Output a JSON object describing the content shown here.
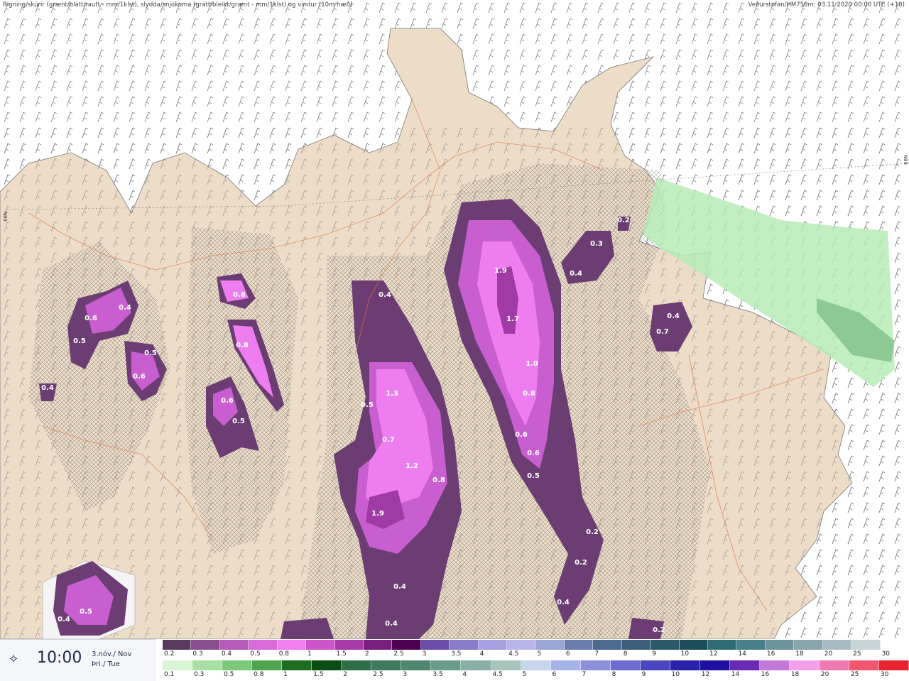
{
  "header": {
    "left_title": "Rigning/skúrir (grænt/blátt/rautt - mm/1klst), slydda/snjókoma (grátt/bleikt/grænt - mm/1klst) og vindur (10m hæð)",
    "right_title": "Veðurstofan/HM750m: 03.11.2020 00:00 UTC (+10)"
  },
  "grid_labels": {
    "left": "66N",
    "right": "66N"
  },
  "time_panel": {
    "time": "10:00",
    "date_line1": "3.nóv./ Nov",
    "date_line2": "Þri./ Tue",
    "icon": "compass-star-icon"
  },
  "legend_snow": {
    "ticks": [
      "0.2",
      "0.3",
      "0.4",
      "0.5",
      "0.8",
      "1",
      "1.5",
      "2",
      "2.5",
      "3",
      "3.5",
      "4",
      "4.5",
      "5",
      "6",
      "7",
      "8",
      "9",
      "10",
      "12",
      "14",
      "16",
      "18",
      "20",
      "25",
      "30"
    ],
    "colors": [
      "#5a3b5f",
      "#8a4e8e",
      "#b55bb8",
      "#d86ad9",
      "#f07ef0",
      "#cc55cc",
      "#a63aa8",
      "#7a1f7e",
      "#4d0052",
      "#6a4da8",
      "#8a7acb",
      "#a8a0e0",
      "#b7b4ec",
      "#9aa6d6",
      "#6a7bb0",
      "#4c6a8f",
      "#3c5e7a",
      "#2c5a6a",
      "#1c4d5a",
      "#2f6b74",
      "#47808a",
      "#6b949c",
      "#8aa6ad",
      "#aabcc1",
      "#c8d4d6",
      "#ffffff"
    ]
  },
  "legend_rain": {
    "ticks": [
      "0.1",
      "0.3",
      "0.5",
      "0.8",
      "1",
      "1.5",
      "2",
      "2.5",
      "3",
      "3.5",
      "4",
      "4.5",
      "5",
      "6",
      "7",
      "8",
      "9",
      "10",
      "12",
      "14",
      "16",
      "18",
      "20",
      "25",
      "30"
    ],
    "colors": [
      "#d8f5d4",
      "#a8dfa2",
      "#7cc779",
      "#4fa54e",
      "#1d6e23",
      "#0b4d14",
      "#2f6d47",
      "#3f7a5d",
      "#4f8770",
      "#6b9b8b",
      "#87afa5",
      "#a7c4bd",
      "#c5d6ee",
      "#a5b3e8",
      "#8a90dc",
      "#6f6ccf",
      "#4a46c0",
      "#2a22aa",
      "#1f10a0",
      "#6a2ab4",
      "#c27ad8",
      "#f2a0ea",
      "#f07ab0",
      "#f0566e",
      "#e8222f"
    ]
  },
  "precip_labels": [
    "0.2",
    "0.3",
    "0.4",
    "1.9",
    "1.7",
    "1.0",
    "0.8",
    "0.6",
    "0.6",
    "0.5",
    "0.2",
    "0.2",
    "0.4",
    "0.4",
    "0.4",
    "0.7",
    "0.8",
    "0.8",
    "0.6",
    "0.5",
    "0.5",
    "0.6",
    "0.4",
    "0.6",
    "0.5",
    "0.4",
    "1.3",
    "0.5",
    "0.7",
    "1.2",
    "0.8",
    "1.9",
    "0.4",
    "0.4",
    "0.5",
    "0.4",
    "0.2"
  ]
}
